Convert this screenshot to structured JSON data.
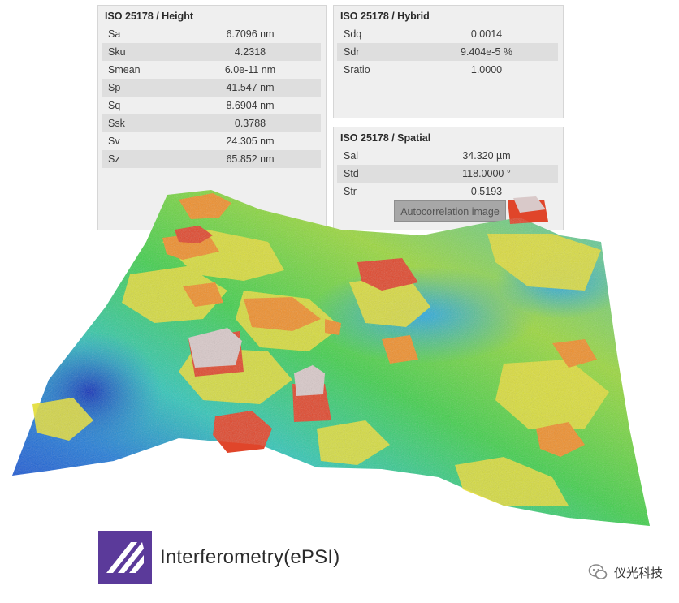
{
  "height_panel": {
    "title": "ISO 25178 / Height",
    "rows": [
      {
        "name": "Sa",
        "value": "6.7096 nm"
      },
      {
        "name": "Sku",
        "value": "4.2318"
      },
      {
        "name": "Smean",
        "value": "6.0e-11 nm"
      },
      {
        "name": "Sp",
        "value": "41.547 nm"
      },
      {
        "name": "Sq",
        "value": "8.6904 nm"
      },
      {
        "name": "Ssk",
        "value": "0.3788"
      },
      {
        "name": "Sv",
        "value": "24.305 nm"
      },
      {
        "name": "Sz",
        "value": "65.852 nm"
      }
    ]
  },
  "hybrid_panel": {
    "title": "ISO 25178 / Hybrid",
    "rows": [
      {
        "name": "Sdq",
        "value": "0.0014"
      },
      {
        "name": "Sdr",
        "value": "9.404e-5 %"
      },
      {
        "name": "Sratio",
        "value": "1.0000"
      }
    ]
  },
  "spatial_panel": {
    "title": "ISO 25178 / Spatial",
    "rows": [
      {
        "name": "Sal",
        "value": "34.320 µm"
      },
      {
        "name": "Std",
        "value": "118.0000 °"
      },
      {
        "name": "Str",
        "value": "0.5193"
      }
    ],
    "button_label": "Autocorrelation image"
  },
  "logo": {
    "text": "Interferometry(ePSI)",
    "color": "#5b3a9a"
  },
  "watermark": {
    "text": "仪光科技"
  },
  "surface_colors": {
    "low": "#1a3fd0",
    "mid_low": "#27c2c8",
    "mid": "#3fcf4a",
    "mid_high": "#e6e23a",
    "high": "#f08a2a",
    "peak": "#e0402a",
    "top": "#d9c8c8"
  }
}
